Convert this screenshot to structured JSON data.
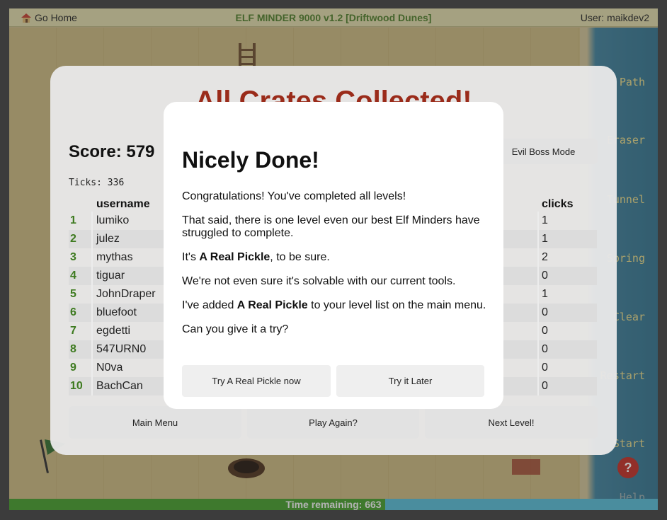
{
  "topbar": {
    "home_label": "Go Home",
    "title": "ELF MINDER 9000 v1.2 [Driftwood Dunes]",
    "user": "User: maikdev2"
  },
  "sidebar": {
    "tools": [
      "Path",
      "Eraser",
      "Tunnel",
      "Spring",
      "Clear",
      "Restart",
      "Start",
      "Help"
    ]
  },
  "timer": {
    "label": "Time remaining: 663",
    "fraction_remaining": 0.58
  },
  "results": {
    "heading": "All Crates Collected!",
    "score": "Score: 579",
    "ticks": "Ticks: 336",
    "evil_boss_label": "Evil Boss Mode",
    "columns": {
      "username": "username",
      "clicks": "clicks"
    },
    "rows": [
      {
        "rank": "1",
        "username": "lumiko",
        "clicks": "1"
      },
      {
        "rank": "2",
        "username": "julez",
        "clicks": "1"
      },
      {
        "rank": "3",
        "username": "mythas",
        "clicks": "2"
      },
      {
        "rank": "4",
        "username": "tiguar",
        "clicks": "0"
      },
      {
        "rank": "5",
        "username": "JohnDraper",
        "clicks": "1"
      },
      {
        "rank": "6",
        "username": "bluefoot",
        "clicks": "0"
      },
      {
        "rank": "7",
        "username": "egdetti",
        "clicks": "0"
      },
      {
        "rank": "8",
        "username": "547URN0",
        "clicks": "0"
      },
      {
        "rank": "9",
        "username": "N0va",
        "clicks": "0"
      },
      {
        "rank": "10",
        "username": "BachCan",
        "clicks": "0"
      }
    ],
    "buttons": {
      "main_menu": "Main Menu",
      "play_again": "Play Again?",
      "next_level": "Next Level!"
    }
  },
  "modal": {
    "title": "Nicely Done!",
    "p1": "Congratulations! You've completed all levels!",
    "p2": "That said, there is one level even our best Elf Minders have struggled to complete.",
    "p3_pre": "It's ",
    "p3_bold": "A Real Pickle",
    "p3_post": ", to be sure.",
    "p4": "We're not even sure it's solvable with our current tools.",
    "p5_pre": "I've added ",
    "p5_bold": "A Real Pickle",
    "p5_post": " to your level list on the main menu.",
    "p6": "Can you give it a try?",
    "btn_try_now": "Try A Real Pickle now",
    "btn_later": "Try it Later"
  },
  "colors": {
    "title_green": "#4b7a24",
    "heading_red": "#9a2b1a",
    "rank_green": "#3d7a1f",
    "timer_green": "#3f9a25",
    "timer_blue": "#52b8d3"
  }
}
